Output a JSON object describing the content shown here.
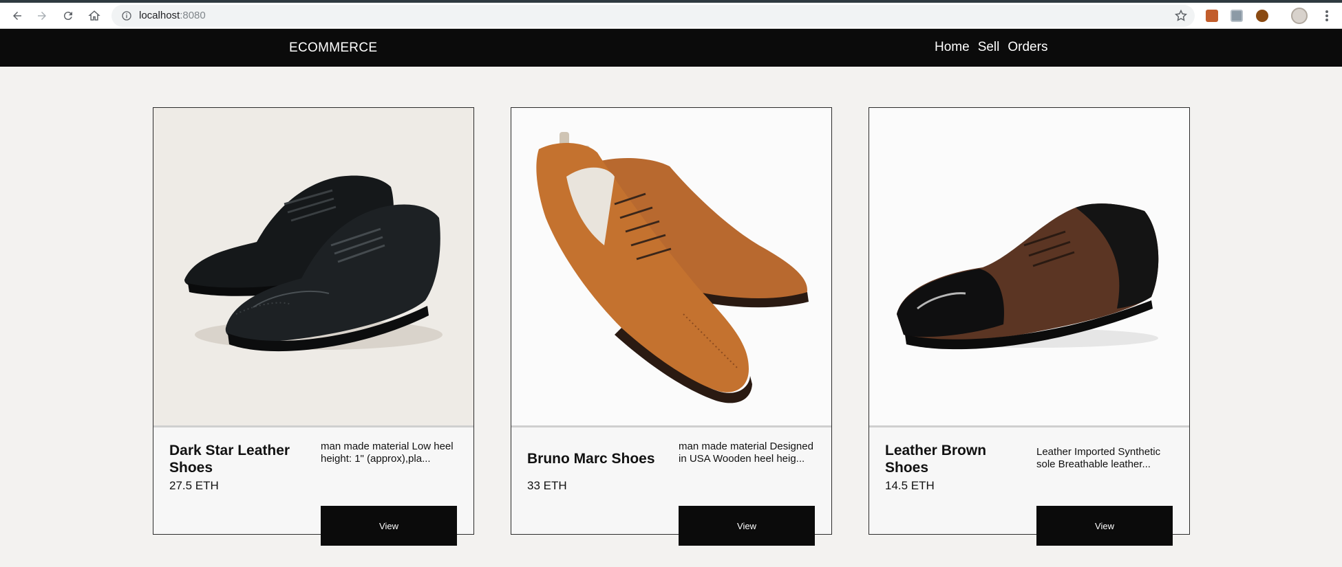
{
  "browser": {
    "url_host": "localhost",
    "url_port": ":8080"
  },
  "navbar": {
    "brand": "ECOMMERCE",
    "links": [
      "Home",
      "Sell",
      "Orders"
    ]
  },
  "products": [
    {
      "title": "Dark Star Leather Shoes",
      "price": "27.5 ETH",
      "description": "man made material Low heel height: 1\" (approx),pla...",
      "view_label": "View",
      "image_icon": "black-oxford-shoes",
      "color": "#1a1c1e"
    },
    {
      "title": "Bruno Marc Shoes",
      "price": "33 ETH",
      "description": "man made material Designed in USA Wooden heel heig...",
      "view_label": "View",
      "image_icon": "tan-suede-oxford-shoes",
      "color": "#b9662e"
    },
    {
      "title": "Leather Brown Shoes",
      "price": "14.5 ETH",
      "description": "Leather Imported Synthetic sole Breathable leather...",
      "view_label": "View",
      "image_icon": "brown-black-derby-shoe",
      "color": "#5a3422"
    }
  ]
}
